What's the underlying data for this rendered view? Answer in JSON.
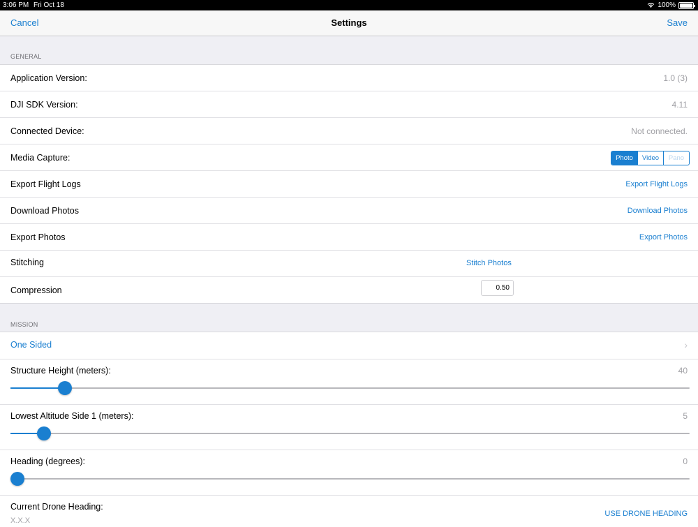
{
  "status": {
    "time": "3:06 PM",
    "date": "Fri Oct 18",
    "battery": "100%",
    "battery_level": 1.0
  },
  "nav": {
    "cancel": "Cancel",
    "title": "Settings",
    "save": "Save"
  },
  "general": {
    "header": "GENERAL",
    "app_version": {
      "label": "Application Version:",
      "value": "1.0 (3)"
    },
    "sdk_version": {
      "label": "DJI SDK Version:",
      "value": "4.11"
    },
    "connected": {
      "label": "Connected Device:",
      "value": "Not connected."
    },
    "media": {
      "label": "Media Capture:",
      "options": [
        "Photo",
        "Video",
        "Pano"
      ],
      "selected": "Photo",
      "disabled": "Pano"
    },
    "export_logs": {
      "label": "Export Flight Logs",
      "action": "Export Flight Logs"
    },
    "download_photos": {
      "label": "Download Photos",
      "action": "Download Photos"
    },
    "export_photos": {
      "label": "Export Photos",
      "action": "Export Photos"
    },
    "stitching": {
      "label": "Stitching",
      "action": "Stitch Photos"
    },
    "compression": {
      "label": "Compression",
      "value": "0.50"
    }
  },
  "mission": {
    "header": "MISSION",
    "type": "One Sided",
    "structure_height": {
      "label": "Structure Height (meters):",
      "value": "40",
      "fraction": 0.07
    },
    "lowest_altitude": {
      "label": "Lowest Altitude Side 1 (meters):",
      "value": "5",
      "fraction": 0.039
    },
    "heading": {
      "label": "Heading (degrees):",
      "value": "0",
      "fraction": 0.0
    },
    "drone_heading": {
      "label": "Current Drone Heading:",
      "value": "X.X.X",
      "action": "USE DRONE HEADING"
    }
  }
}
